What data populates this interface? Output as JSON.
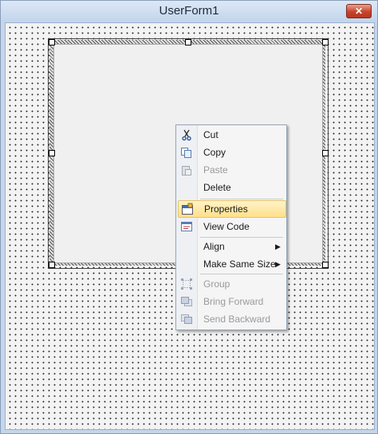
{
  "window": {
    "title": "UserForm1",
    "close_glyph": "✕"
  },
  "context_menu": {
    "items": [
      {
        "label": "Cut",
        "icon": "scissors-icon",
        "enabled": true
      },
      {
        "label": "Copy",
        "icon": "copy-icon",
        "enabled": true
      },
      {
        "label": "Paste",
        "icon": "paste-icon",
        "enabled": false
      },
      {
        "label": "Delete",
        "icon": "",
        "enabled": true
      },
      {
        "label": "Properties",
        "icon": "properties-icon",
        "enabled": true,
        "highlighted": true
      },
      {
        "label": "View Code",
        "icon": "view-code-icon",
        "enabled": true
      },
      {
        "label": "Align",
        "icon": "",
        "enabled": true,
        "submenu": true
      },
      {
        "label": "Make Same Size",
        "icon": "",
        "enabled": true,
        "submenu": true
      },
      {
        "label": "Group",
        "icon": "group-icon",
        "enabled": false
      },
      {
        "label": "Bring Forward",
        "icon": "bring-forward-icon",
        "enabled": false
      },
      {
        "label": "Send Backward",
        "icon": "send-backward-icon",
        "enabled": false
      }
    ],
    "submenu_arrow": "▶"
  },
  "colors": {
    "highlight": "#ffe08a",
    "disabled_text": "#9a9a9a",
    "close_button": "#c7432b"
  }
}
